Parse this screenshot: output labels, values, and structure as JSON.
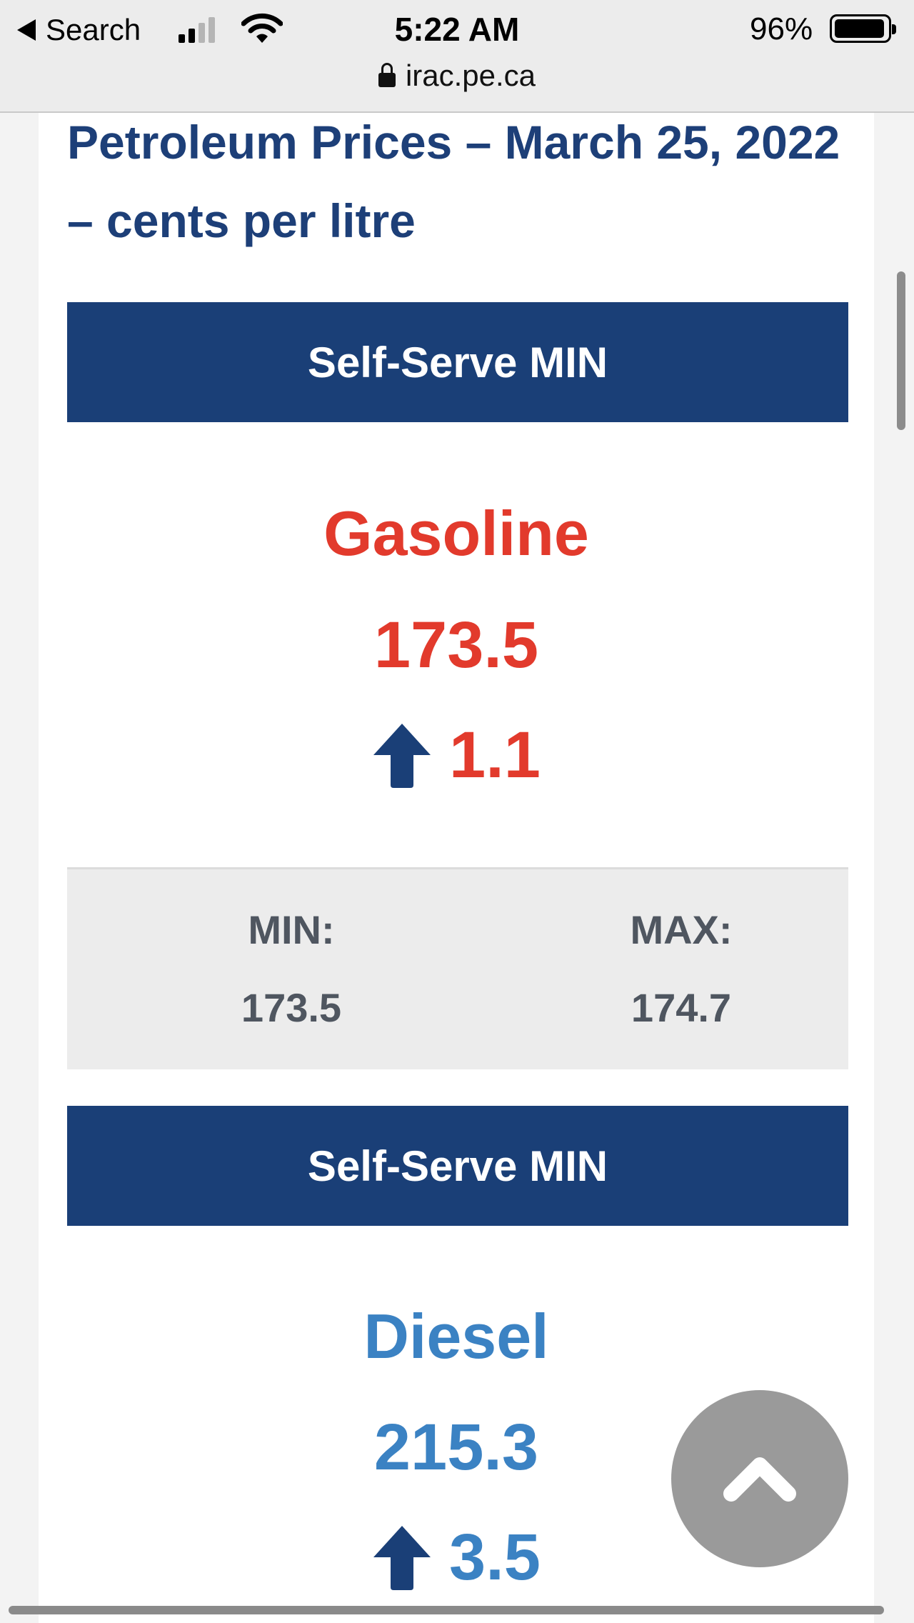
{
  "status_bar": {
    "back_label": "Search",
    "time": "5:22 AM",
    "battery_percent": "96%"
  },
  "browser": {
    "url": "irac.pe.ca"
  },
  "page": {
    "title": "Petroleum Prices – March 25, 2022 – cents per litre"
  },
  "fuels": [
    {
      "banner": "Self-Serve MIN",
      "name": "Gasoline",
      "price": "173.5",
      "change": "1.1",
      "min_label": "MIN:",
      "min_value": "173.5",
      "max_label": "MAX:",
      "max_value": "174.7"
    },
    {
      "banner": "Self-Serve MIN",
      "name": "Diesel",
      "price": "215.3",
      "change": "3.5"
    }
  ],
  "colors": {
    "banner": "#1a3f77",
    "gasoline": "#e23a2c",
    "diesel": "#3b82c3",
    "title": "#1d3f78"
  },
  "icons": {
    "change_direction": "up-arrow-icon",
    "back_to_top": "chevron-up-icon"
  }
}
